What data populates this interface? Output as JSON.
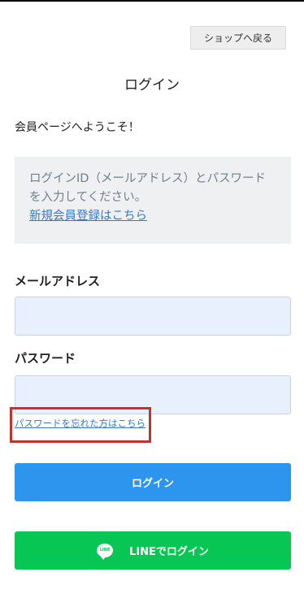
{
  "header": {
    "shop_back_label": "ショップへ戻る"
  },
  "page": {
    "title": "ログイン",
    "welcome": "会員ページへようこそ！"
  },
  "info": {
    "text": "ログインID（メールアドレス）とパスワードを入力してください。",
    "register_link": "新規会員登録はこちら"
  },
  "form": {
    "email_label": "メールアドレス",
    "email_value": "",
    "password_label": "パスワード",
    "password_value": "",
    "forgot_link": "パスワードを忘れた方はこちら",
    "login_button": "ログイン",
    "line_button": "LINEでログイン",
    "line_icon_text": "LINE"
  },
  "colors": {
    "login_button": "#2e95ee",
    "line_button": "#08c654",
    "highlight_box": "#c0342f",
    "link": "#3a79c6"
  },
  "icons": {
    "line": "line-chat-icon"
  }
}
